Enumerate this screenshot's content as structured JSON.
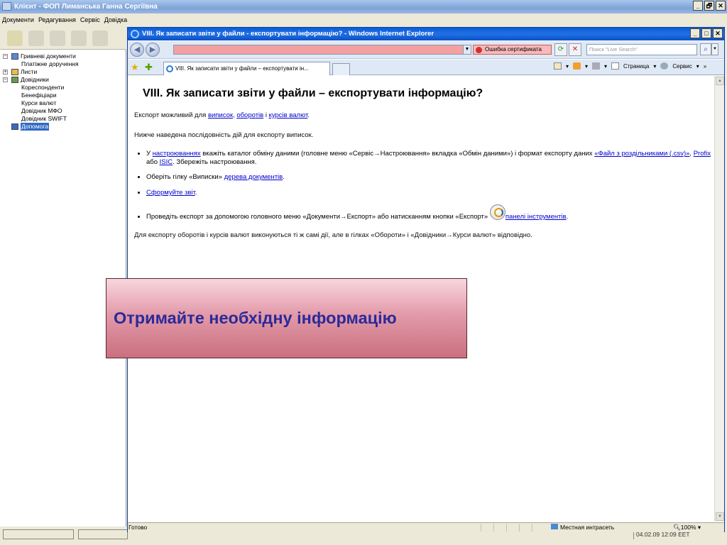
{
  "outer_window": {
    "title": "Клієнт - ФОП Лиманська Ганна Сергіївна",
    "controls": [
      "_",
      "🗗",
      "✕"
    ]
  },
  "menu": [
    "Документи",
    "Редагування",
    "Сервіс",
    "Довідка"
  ],
  "tree": [
    {
      "label": "Гривневі документи",
      "expander": "-",
      "icon": "document-icon",
      "indent": 0
    },
    {
      "label": "Платіжне доручення",
      "expander": "",
      "icon": "",
      "indent": 1
    },
    {
      "label": "Листи",
      "expander": "+",
      "icon": "envelope-icon",
      "indent": 0
    },
    {
      "label": "Довідники",
      "expander": "-",
      "icon": "books-icon",
      "indent": 0
    },
    {
      "label": "Кореспонденти",
      "expander": "",
      "icon": "",
      "indent": 1
    },
    {
      "label": "Бенефіціари",
      "expander": "",
      "icon": "",
      "indent": 1
    },
    {
      "label": "Курси валют",
      "expander": "",
      "icon": "",
      "indent": 1
    },
    {
      "label": "Довідник МФО",
      "expander": "",
      "icon": "",
      "indent": 1
    },
    {
      "label": "Довідник SWIFT",
      "expander": "",
      "icon": "",
      "indent": 1
    },
    {
      "label": "Допомога",
      "expander": "",
      "icon": "help-icon",
      "indent": 0,
      "selected": true
    }
  ],
  "clock": "04.02.09 12:09 EET",
  "ie": {
    "title": "VIII. Як записати звіти у файли - експортувати інформацію? - Windows Internet Explorer",
    "address": "",
    "cert_error": "Ошибка сертификата",
    "search_placeholder": "Поиск \"Live Search\"",
    "tab_label": "VIII. Як записати звіти у файли – експортувати ін...",
    "cmd_page": "Страница",
    "cmd_tools": "Сервис",
    "status_ready": "Готово",
    "status_zone": "Местная интрасеть",
    "status_zoom": "100%"
  },
  "content": {
    "heading": "VIII. Як записати звіти у файли – експортувати інформацію?",
    "p1_prefix": "Експорт можливий для ",
    "p1_link1": "виписок",
    "p1_sep1": ", ",
    "p1_link2": "оборотів",
    "p1_sep2": " і ",
    "p1_link3": "курсів валют",
    "p1_end": ".",
    "p2": "Нижче наведена послідовність дій для експорту виписок.",
    "li1_prefix": "У ",
    "li1_link1": "настроюваннях",
    "li1_mid": " вкажіть каталог обміну даними (головне меню «Сервіс→Настроювання» вкладка «Обмін даними») і формат експорту даних ",
    "li1_link2": "«Файл з роздільниками (.csv)»",
    "li1_sep1": ", ",
    "li1_link3": "Profix",
    "li1_sep2": " або ",
    "li1_link4": "ISIC",
    "li1_end": ". Збережіть настроювання.",
    "li2_prefix": "Оберіть гілку «Виписки» ",
    "li2_link": "дерева документів",
    "li2_end": ".",
    "li3_link": "Сформуйте звіт",
    "li3_end": ".",
    "li4_prefix": "Проведіть експорт за допомогою головного меню «Документи→Експорт» або натисканням кнопки «Експорт» ",
    "li4_link": "панелі інструментів",
    "li4_end": ".",
    "p3": "Для експорту оборотів і курсів валют виконуються ті ж самі дії, але в гілках «Обороти» і «Довідники→Курси валют» відповідно."
  },
  "overlay": {
    "text": "Отримайте необхідну інформацію"
  }
}
